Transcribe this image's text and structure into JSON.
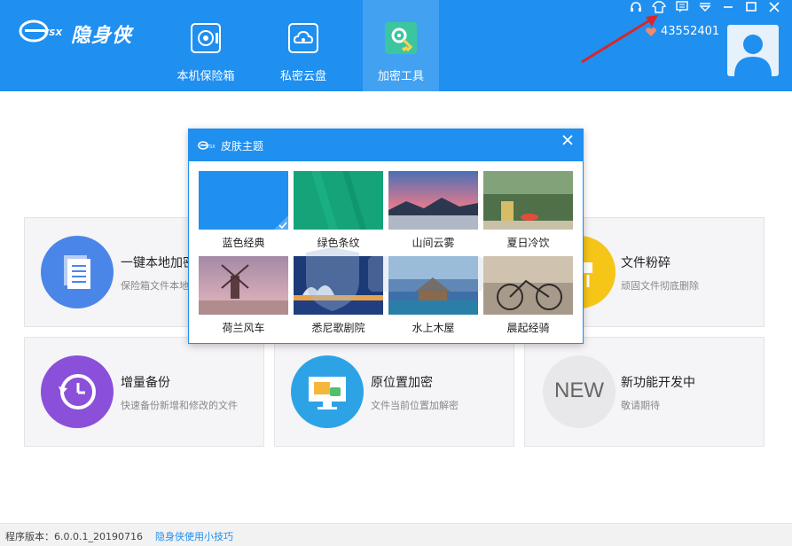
{
  "app": {
    "logo_text": "隐身侠",
    "user_id": "43552401"
  },
  "nav": [
    {
      "label": "本机保险箱",
      "icon": "safe-icon"
    },
    {
      "label": "私密云盘",
      "icon": "cloud-icon"
    },
    {
      "label": "加密工具",
      "icon": "gear-key-icon",
      "active": true
    }
  ],
  "window_controls": [
    "headset-icon",
    "shirt-icon",
    "message-icon",
    "dropdown-icon",
    "minimize-icon",
    "maximize-icon",
    "close-icon"
  ],
  "cards": [
    {
      "title": "一键本地加密",
      "desc": "保险箱文件本地",
      "icon": "documents-icon",
      "color": "#4a86e8"
    },
    {
      "title": "文件粉碎",
      "desc": "顽固文件彻底删除",
      "icon": "shredder-icon",
      "color": "#f5c518"
    },
    {
      "title": "增量备份",
      "desc": "快速备份新增和修改的文件",
      "icon": "clock-backup-icon",
      "color": "#8b50d9"
    },
    {
      "title": "原位置加密",
      "desc": "文件当前位置加解密",
      "icon": "monitor-lock-icon",
      "color": "#2da3e6"
    },
    {
      "title": "新功能开发中",
      "desc": "敬请期待",
      "icon": "new-icon",
      "badge": "NEW",
      "color": "#e6e6e6"
    }
  ],
  "dialog": {
    "title": "皮肤主题",
    "skins": [
      {
        "label": "蓝色经典",
        "selected": true
      },
      {
        "label": "绿色条纹"
      },
      {
        "label": "山间云雾"
      },
      {
        "label": "夏日冷饮"
      },
      {
        "label": "荷兰风车"
      },
      {
        "label": "悉尼歌剧院"
      },
      {
        "label": "水上木屋"
      },
      {
        "label": "晨起经骑"
      }
    ]
  },
  "footer": {
    "version": "程序版本：6.0.0.1_20190716",
    "tips": "隐身侠使用小技巧"
  },
  "colors": {
    "primary": "#1f8ff0",
    "arrow": "#d9262a"
  }
}
